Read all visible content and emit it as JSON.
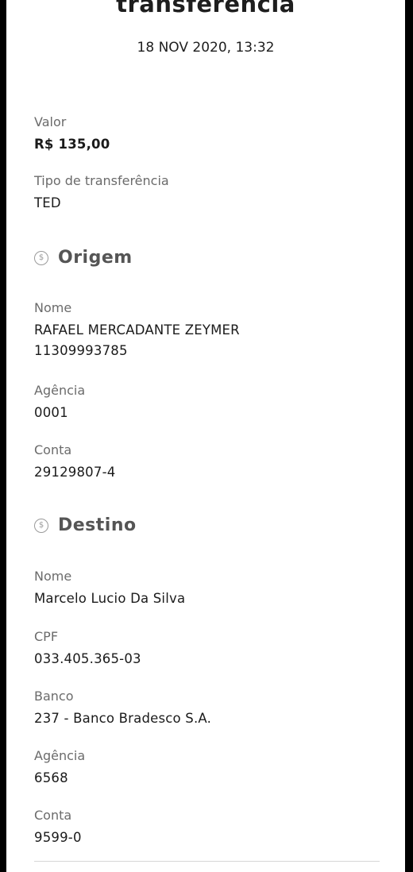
{
  "header": {
    "title": "transferência",
    "datetime": "18 NOV 2020, 13:32"
  },
  "summary": {
    "valor_label": "Valor",
    "valor_value": "R$ 135,00",
    "tipo_label": "Tipo de transferência",
    "tipo_value": "TED"
  },
  "origem": {
    "section_title": "Origem",
    "icon": "dollar-coin-icon",
    "nome_label": "Nome",
    "nome_value": "RAFAEL MERCADANTE ZEYMER",
    "documento_value": "11309993785",
    "agencia_label": "Agência",
    "agencia_value": "0001",
    "conta_label": "Conta",
    "conta_value": "29129807-4"
  },
  "destino": {
    "section_title": "Destino",
    "icon": "dollar-coin-icon",
    "nome_label": "Nome",
    "nome_value": "Marcelo Lucio Da Silva",
    "cpf_label": "CPF",
    "cpf_value": "033.405.365-03",
    "banco_label": "Banco",
    "banco_value": "237 - Banco Bradesco S.A.",
    "agencia_label": "Agência",
    "agencia_value": "6568",
    "conta_label": "Conta",
    "conta_value": "9599-0"
  }
}
